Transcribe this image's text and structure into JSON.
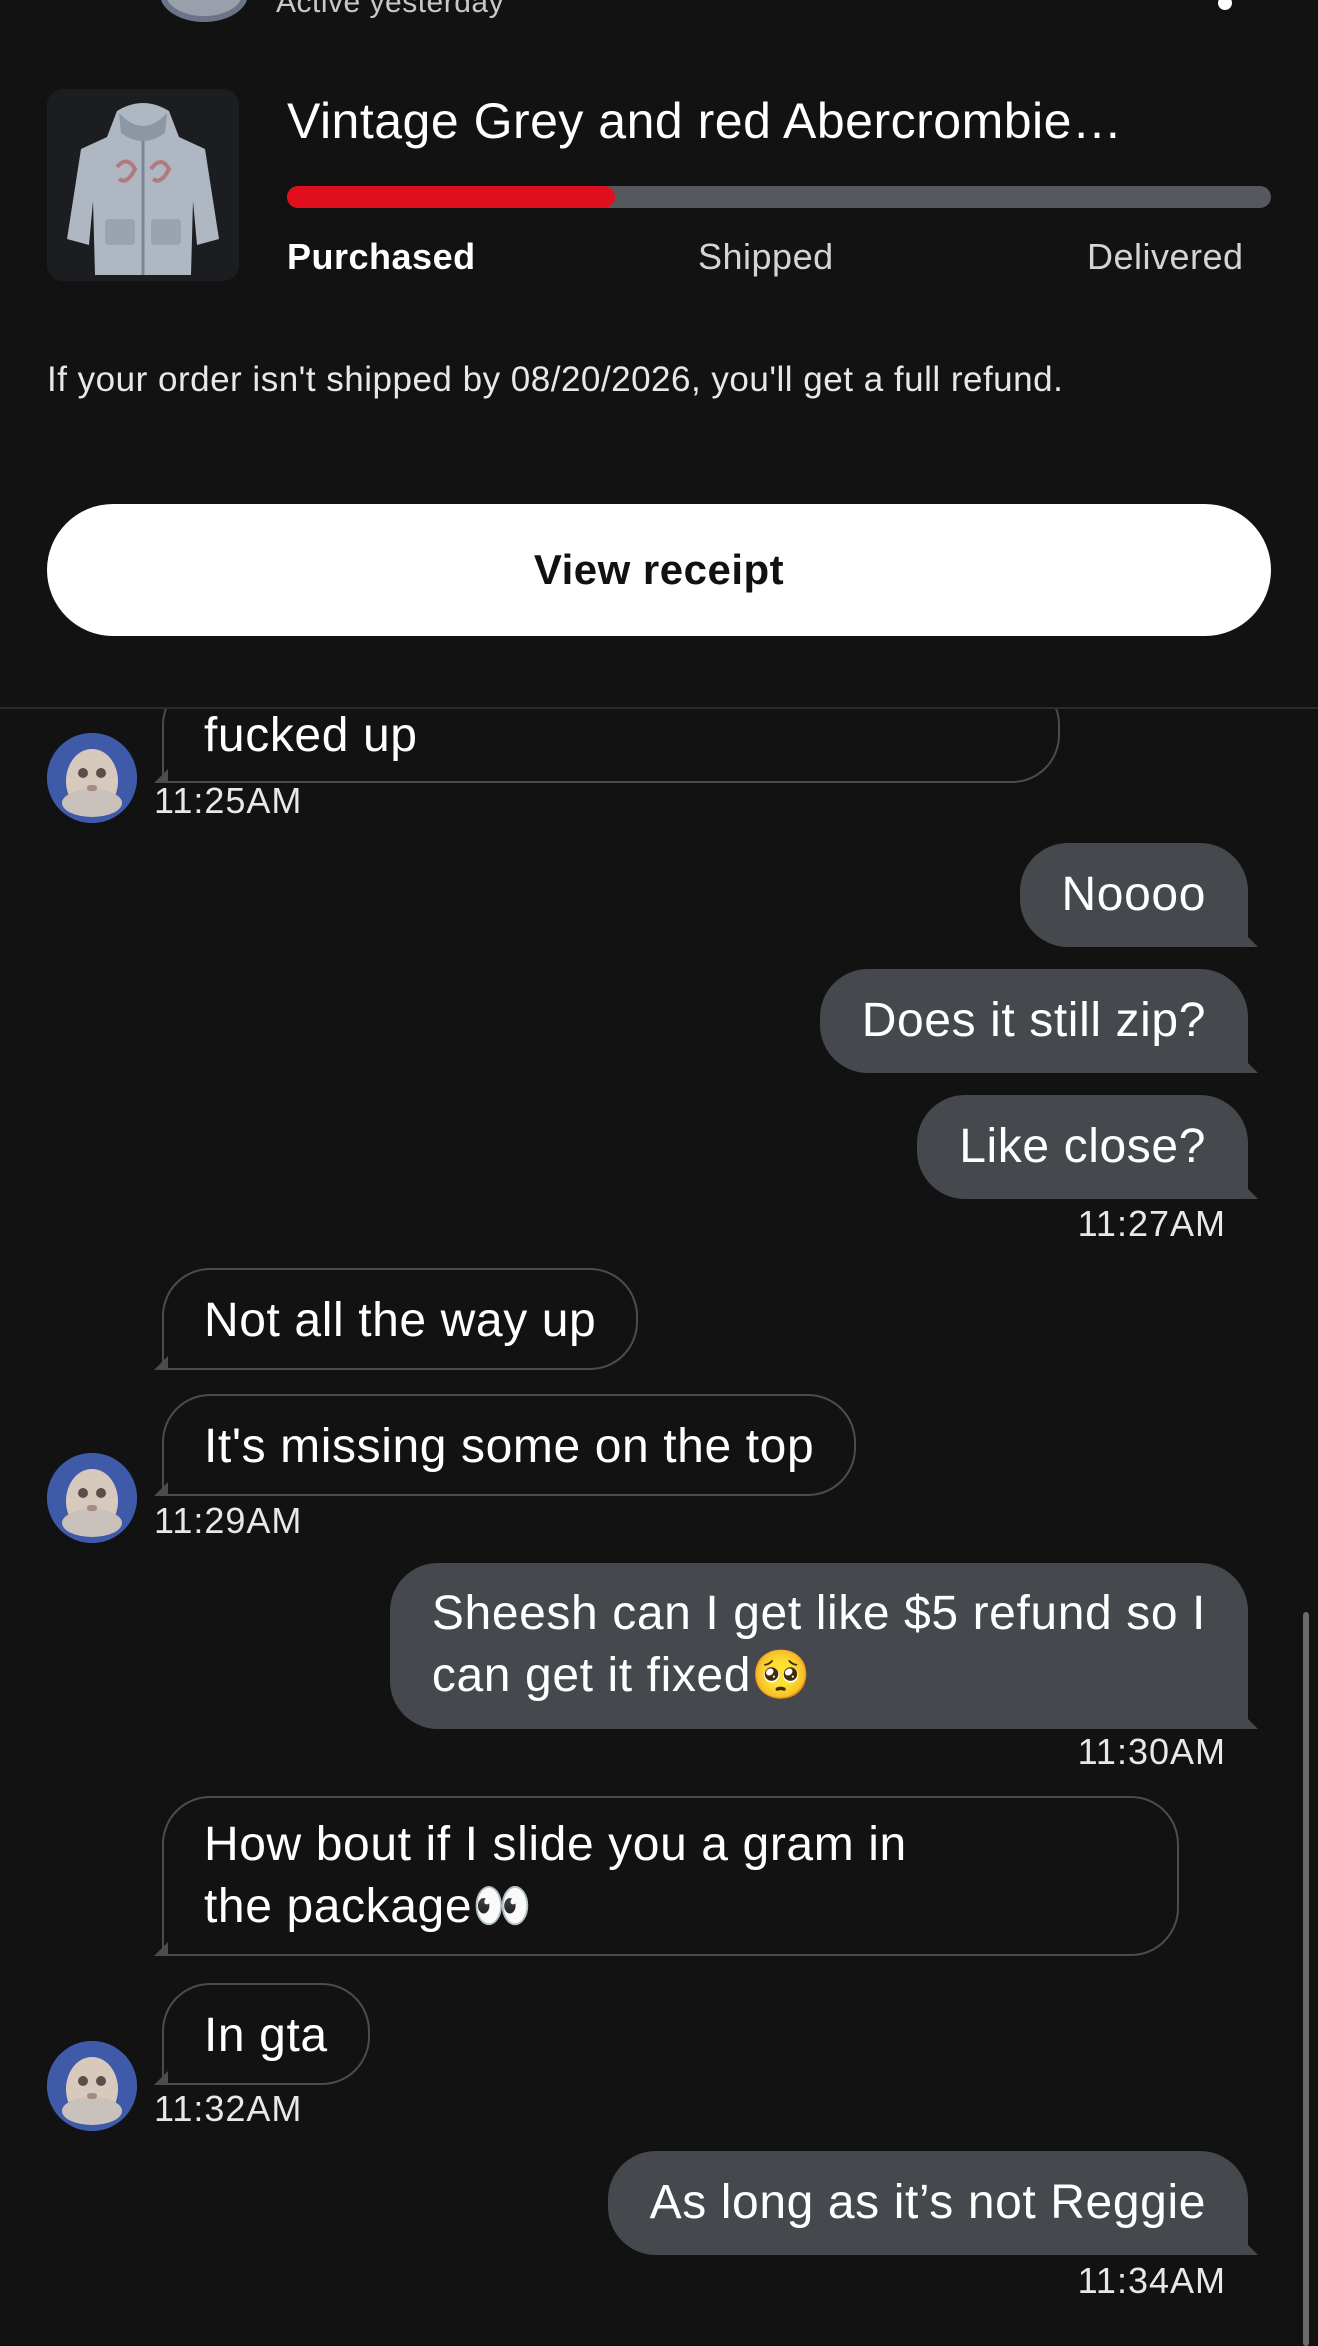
{
  "header": {
    "status": "Active yesterday"
  },
  "order": {
    "item_title": "Vintage Grey and red Abercrombie…",
    "progress_fraction": 0.333,
    "steps": [
      "Purchased",
      "Shipped",
      "Delivered"
    ],
    "current_step": "Purchased",
    "refund_note": "If your order isn't shipped by 08/20/2026, you'll get a full refund.",
    "view_receipt_label": "View receipt"
  },
  "messages": [
    {
      "from": "them",
      "text": "fucked up"
    },
    {
      "from": "them",
      "time": "11:25AM"
    },
    {
      "from": "me",
      "text": "Noooo"
    },
    {
      "from": "me",
      "text": "Does it still zip?"
    },
    {
      "from": "me",
      "text": "Like close?"
    },
    {
      "from": "me",
      "time": "11:27AM"
    },
    {
      "from": "them",
      "text": "Not all the way up"
    },
    {
      "from": "them",
      "text": "It's missing some on the top"
    },
    {
      "from": "them",
      "time": "11:29AM"
    },
    {
      "from": "me",
      "text_line1": "Sheesh can I get like $5 refund so I",
      "text_line2": "can get it fixed🥺"
    },
    {
      "from": "me",
      "time": "11:30AM"
    },
    {
      "from": "them",
      "text_line1": "How bout if I slide you a gram in",
      "text_line2": "the package👀"
    },
    {
      "from": "them",
      "text": "In gta"
    },
    {
      "from": "them",
      "time": "11:32AM"
    },
    {
      "from": "me",
      "text": "As long as it’s not Reggie"
    },
    {
      "from": "me",
      "time": "11:34AM"
    }
  ],
  "colors": {
    "background": "#121213",
    "progress_fill": "#e10f1e",
    "progress_track": "#55585c",
    "outgoing_bubble": "#45484d",
    "incoming_border": "#4a4c50",
    "button_bg": "#ffffff"
  }
}
